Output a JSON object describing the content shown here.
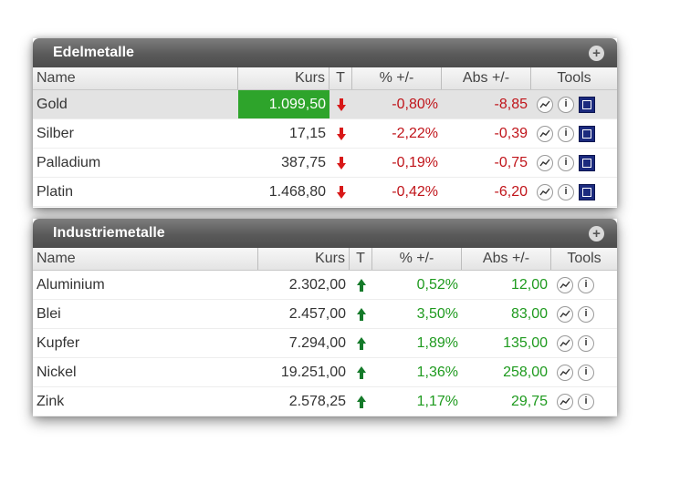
{
  "panels": [
    {
      "title": "Edelmetalle",
      "columns": {
        "name": "Name",
        "kurs": "Kurs",
        "t": "T",
        "pct": "% +/-",
        "abs": "Abs +/-",
        "tools": "Tools"
      },
      "rows": [
        {
          "name": "Gold",
          "kurs": "1.099,50",
          "trend": "down",
          "pct": "-0,80%",
          "abs": "-8,85",
          "highlight": true,
          "selected": true
        },
        {
          "name": "Silber",
          "kurs": "17,15",
          "trend": "down",
          "pct": "-2,22%",
          "abs": "-0,39"
        },
        {
          "name": "Palladium",
          "kurs": "387,75",
          "trend": "down",
          "pct": "-0,19%",
          "abs": "-0,75"
        },
        {
          "name": "Platin",
          "kurs": "1.468,80",
          "trend": "down",
          "pct": "-0,42%",
          "abs": "-6,20"
        }
      ]
    },
    {
      "title": "Industriemetalle",
      "columns": {
        "name": "Name",
        "kurs": "Kurs",
        "t": "T",
        "pct": "% +/-",
        "abs": "Abs +/-",
        "tools": "Tools"
      },
      "rows": [
        {
          "name": "Aluminium",
          "kurs": "2.302,00",
          "trend": "up",
          "pct": "0,52%",
          "abs": "12,00"
        },
        {
          "name": "Blei",
          "kurs": "2.457,00",
          "trend": "up",
          "pct": "3,50%",
          "abs": "83,00"
        },
        {
          "name": "Kupfer",
          "kurs": "7.294,00",
          "trend": "up",
          "pct": "1,89%",
          "abs": "135,00"
        },
        {
          "name": "Nickel",
          "kurs": "19.251,00",
          "trend": "up",
          "pct": "1,36%",
          "abs": "258,00"
        },
        {
          "name": "Zink",
          "kurs": "2.578,25",
          "trend": "up",
          "pct": "1,17%",
          "abs": "29,75"
        }
      ]
    }
  ],
  "icons": {
    "expand": "plus-circle-icon",
    "chart": "chart-icon",
    "info": "info-icon",
    "news": "news-icon"
  },
  "colors": {
    "negative": "#c0141a",
    "positive": "#1e9a1e",
    "highlight": "#2ea42b",
    "header": "#5a5a5a"
  }
}
